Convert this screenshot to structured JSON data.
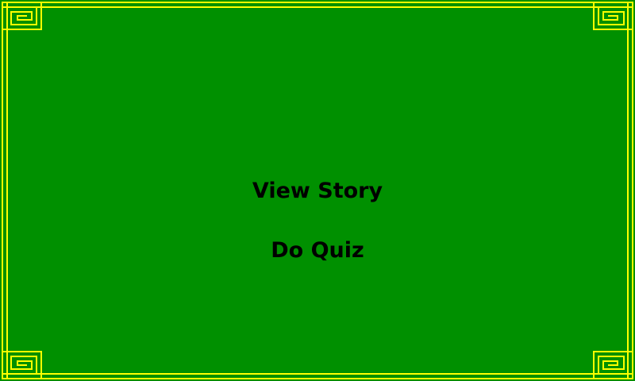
{
  "screen": {
    "background_color": "#009000",
    "border_color": "#ffff00",
    "border_style": "greek-key-corners"
  },
  "menu": {
    "view_story_label": "View Story",
    "do_quiz_label": "Do Quiz"
  }
}
